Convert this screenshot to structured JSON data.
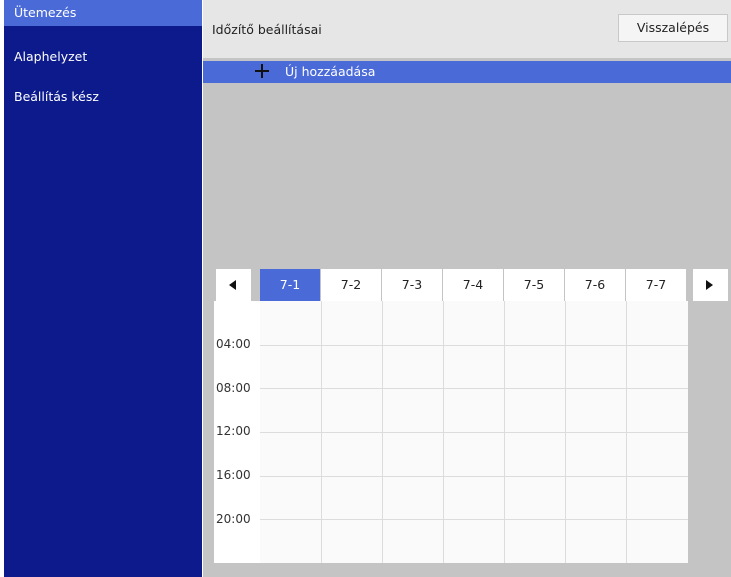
{
  "sidebar": {
    "items": [
      {
        "label": "Ütemezés",
        "active": true
      },
      {
        "label": "Alaphelyzet",
        "active": false
      },
      {
        "label": "Beállítás kész",
        "active": false
      }
    ]
  },
  "header": {
    "title": "Időzítő beállításai",
    "back_label": "Visszalépés"
  },
  "add_row": {
    "icon": "plus-icon",
    "label": "Új hozzáadása"
  },
  "calendar": {
    "prev_icon": "chevron-left-icon",
    "next_icon": "chevron-right-icon",
    "days": [
      "7-1",
      "7-2",
      "7-3",
      "7-4",
      "7-5",
      "7-6",
      "7-7"
    ],
    "active_day": "7-1",
    "times": [
      "04:00",
      "08:00",
      "12:00",
      "16:00",
      "20:00"
    ]
  },
  "colors": {
    "sidebar_bg": "#0c1a8c",
    "accent": "#4a6ad8",
    "content_bg": "#c4c4c4",
    "header_bg": "#e6e6e6"
  }
}
